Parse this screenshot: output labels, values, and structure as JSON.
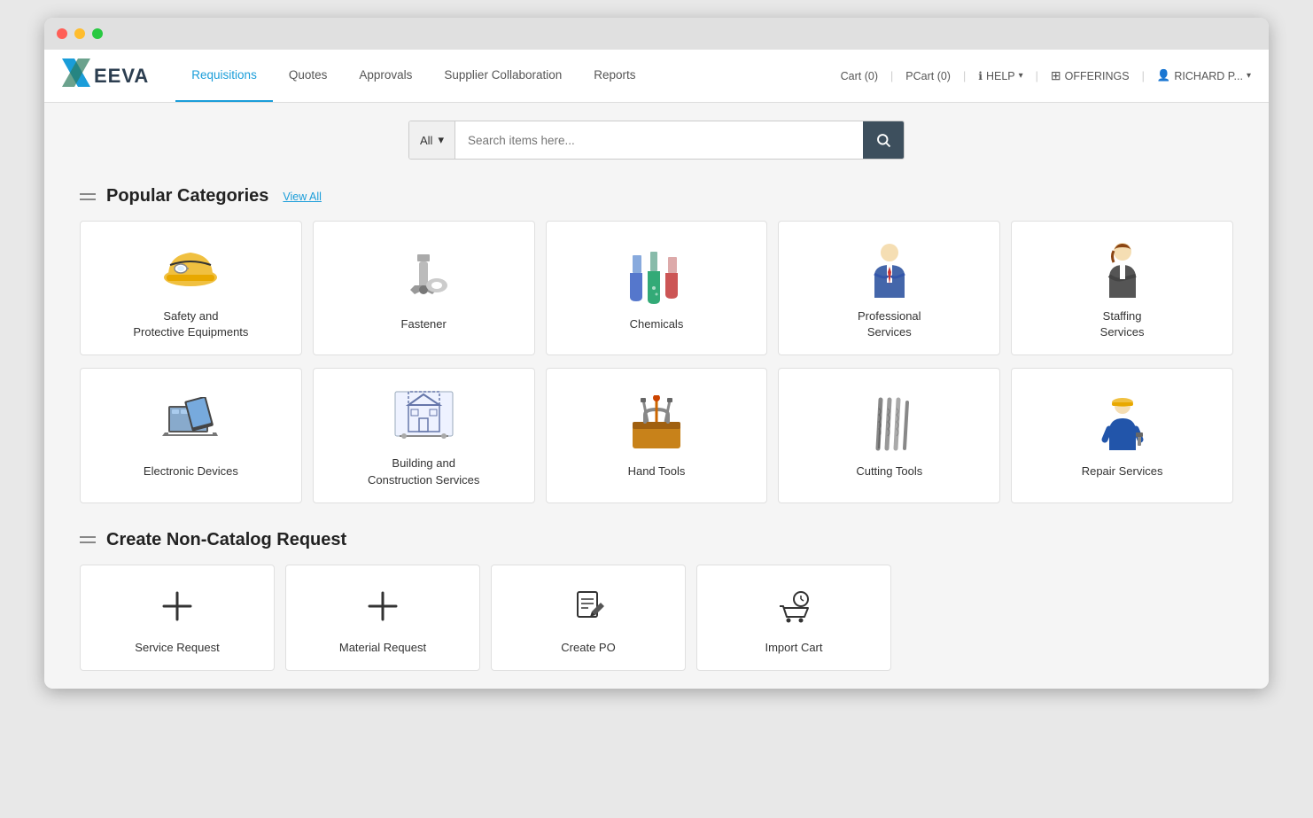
{
  "window": {
    "dots": [
      "red",
      "yellow",
      "green"
    ]
  },
  "header": {
    "logo": {
      "x": "X",
      "eeva": "EEVA"
    },
    "nav": {
      "tabs": [
        {
          "label": "Requisitions",
          "active": true
        },
        {
          "label": "Quotes",
          "active": false
        },
        {
          "label": "Approvals",
          "active": false
        },
        {
          "label": "Supplier Collaboration",
          "active": false
        },
        {
          "label": "Reports",
          "active": false
        }
      ]
    },
    "topRight": {
      "cart": "Cart (0)",
      "pcart": "PCart (0)",
      "help": "HELP",
      "offerings": "OFFERINGS",
      "user": "RICHARD P..."
    }
  },
  "search": {
    "filter_label": "All",
    "placeholder": "Search items here...",
    "button_icon": "🔍"
  },
  "popular_categories": {
    "title": "Popular Categories",
    "view_all": "View All",
    "row1": [
      {
        "id": "safety",
        "label": "Safety and\nProtective Equipments"
      },
      {
        "id": "fastener",
        "label": "Fastener"
      },
      {
        "id": "chemicals",
        "label": "Chemicals"
      },
      {
        "id": "professional",
        "label": "Professional\nServices"
      },
      {
        "id": "staffing",
        "label": "Staffing\nServices"
      }
    ],
    "row2": [
      {
        "id": "electronic",
        "label": "Electronic Devices"
      },
      {
        "id": "building",
        "label": "Building and\nConstruction Services"
      },
      {
        "id": "handtools",
        "label": "Hand Tools"
      },
      {
        "id": "cuttingtools",
        "label": "Cutting Tools"
      },
      {
        "id": "repair",
        "label": "Repair Services"
      }
    ]
  },
  "non_catalog": {
    "title": "Create Non-Catalog Request",
    "items": [
      {
        "id": "service-request",
        "label": "Service Request"
      },
      {
        "id": "material-request",
        "label": "Material Request"
      },
      {
        "id": "create-po",
        "label": "Create PO"
      },
      {
        "id": "import-cart",
        "label": "Import Cart"
      }
    ]
  }
}
